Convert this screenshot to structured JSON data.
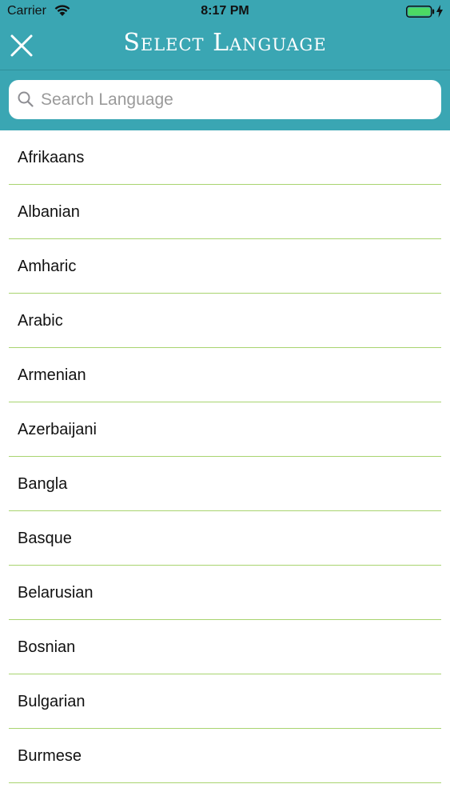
{
  "status_bar": {
    "carrier": "Carrier",
    "time": "8:17 PM",
    "battery_color": "#4cd964"
  },
  "header": {
    "title": "Select Language",
    "background_color": "#3aa6b3",
    "close_icon": "close-icon"
  },
  "search": {
    "placeholder": "Search Language",
    "value": "",
    "icon": "search-icon"
  },
  "languages": [
    "Afrikaans",
    "Albanian",
    "Amharic",
    "Arabic",
    "Armenian",
    "Azerbaijani",
    "Bangla",
    "Basque",
    "Belarusian",
    "Bosnian",
    "Bulgarian",
    "Burmese"
  ],
  "divider_color": "#a8d46f"
}
